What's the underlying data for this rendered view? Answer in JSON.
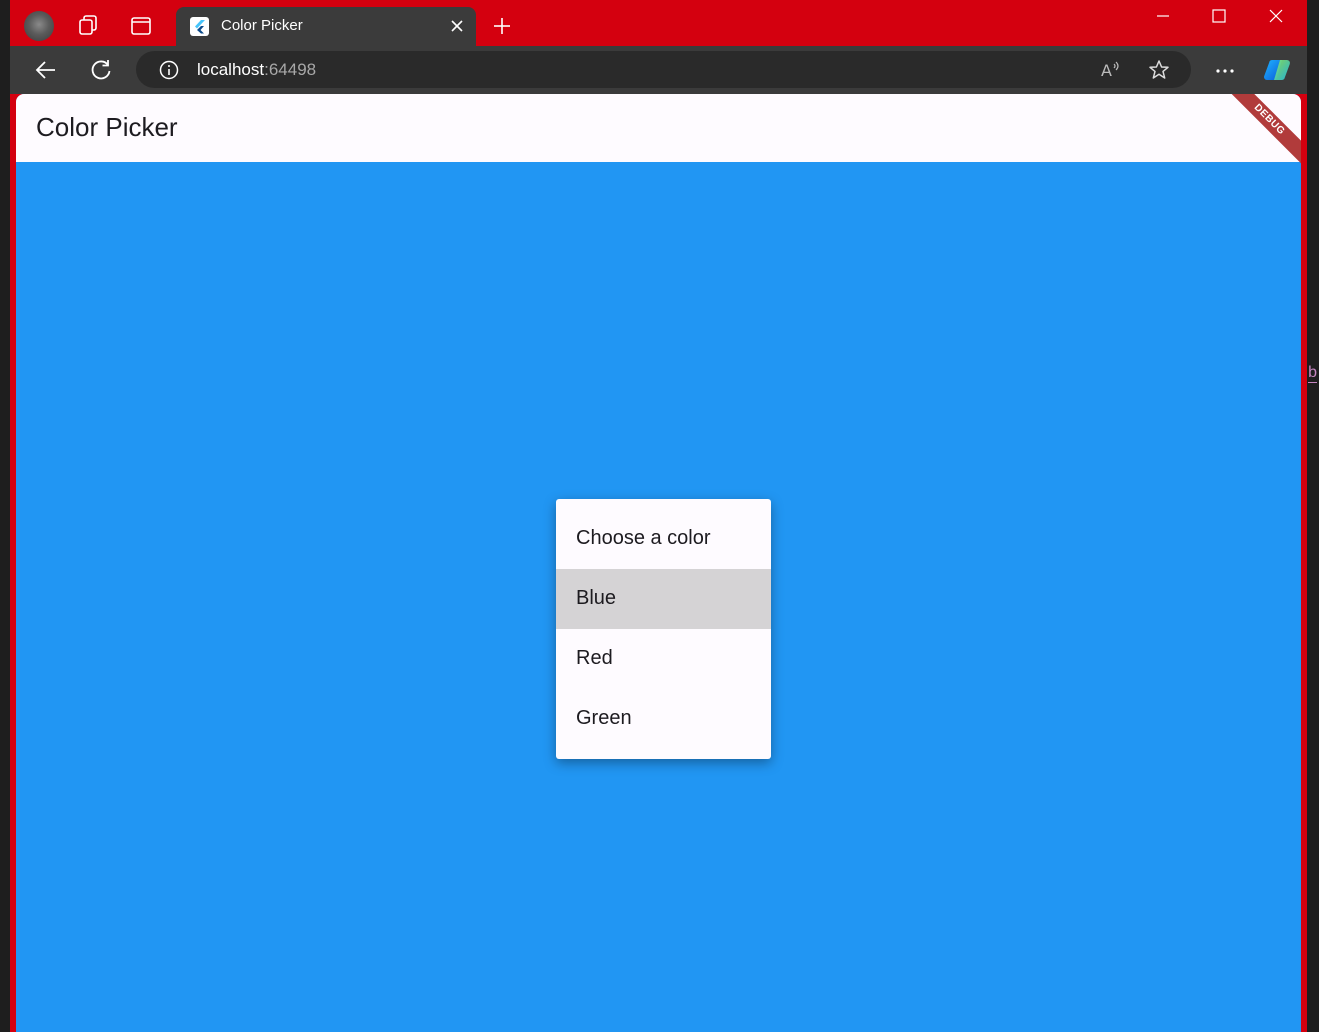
{
  "browser": {
    "tab_title": "Color Picker",
    "url_host": "localhost",
    "url_port": ":64498"
  },
  "app": {
    "title": "Color Picker",
    "debug_banner": "DEBUG",
    "background_color": "#2196f3"
  },
  "menu": {
    "items": [
      {
        "label": "Choose a color",
        "selected": false
      },
      {
        "label": "Blue",
        "selected": true
      },
      {
        "label": "Red",
        "selected": false
      },
      {
        "label": "Green",
        "selected": false
      }
    ]
  },
  "peek": {
    "text": "b"
  }
}
